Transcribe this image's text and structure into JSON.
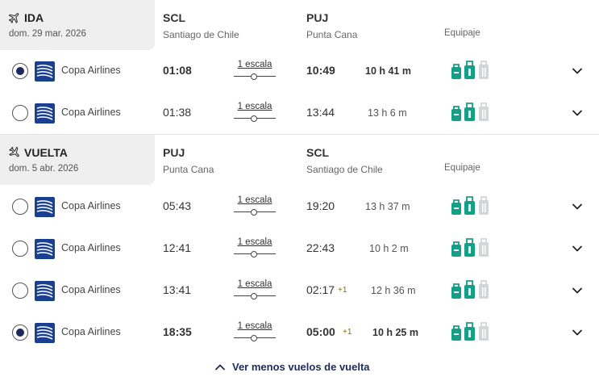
{
  "outbound": {
    "direction_label": "IDA",
    "date": "dom. 29 mar. 2026",
    "origin": {
      "code": "SCL",
      "city": "Santiago de Chile"
    },
    "destination": {
      "code": "PUJ",
      "city": "Punta Cana"
    },
    "baggage_header": "Equipaje",
    "flights": [
      {
        "selected": true,
        "airline": "Copa Airlines",
        "departure": "01:08",
        "stops": "1 escala",
        "arrival": "10:49",
        "next_day": "",
        "duration": "10 h 41 m"
      },
      {
        "selected": false,
        "airline": "Copa Airlines",
        "departure": "01:38",
        "stops": "1 escala",
        "arrival": "13:44",
        "next_day": "",
        "duration": "13 h 6 m"
      }
    ]
  },
  "return": {
    "direction_label": "VUELTA",
    "date": "dom. 5 abr. 2026",
    "origin": {
      "code": "PUJ",
      "city": "Punta Cana"
    },
    "destination": {
      "code": "SCL",
      "city": "Santiago de Chile"
    },
    "baggage_header": "Equipaje",
    "flights": [
      {
        "selected": false,
        "airline": "Copa Airlines",
        "departure": "05:43",
        "stops": "1 escala",
        "arrival": "19:20",
        "next_day": "",
        "duration": "13 h 37 m"
      },
      {
        "selected": false,
        "airline": "Copa Airlines",
        "departure": "12:41",
        "stops": "1 escala",
        "arrival": "22:43",
        "next_day": "",
        "duration": "10 h 2 m"
      },
      {
        "selected": false,
        "airline": "Copa Airlines",
        "departure": "13:41",
        "stops": "1 escala",
        "arrival": "02:17",
        "next_day": "+1",
        "duration": "12 h 36 m"
      },
      {
        "selected": true,
        "airline": "Copa Airlines",
        "departure": "18:35",
        "stops": "1 escala",
        "arrival": "05:00",
        "next_day": "+1",
        "duration": "10 h 25 m"
      }
    ],
    "show_less_label": "Ver menos vuelos de vuelta"
  },
  "icons": {
    "outbound": "plane-takeoff-icon",
    "return": "plane-landing-icon",
    "baggage": [
      "personal-item-icon",
      "carry-on-icon",
      "checked-bag-icon"
    ],
    "expand": "chevron-down-icon",
    "collapse": "chevron-up-icon"
  },
  "colors": {
    "selected_radio": "#1f2a5c",
    "baggage_included": "#159f86",
    "baggage_not_included": "#d3d6d8",
    "link": "#1f2a5c",
    "next_day": "#8a6d00",
    "header_bg": "#efefef"
  }
}
